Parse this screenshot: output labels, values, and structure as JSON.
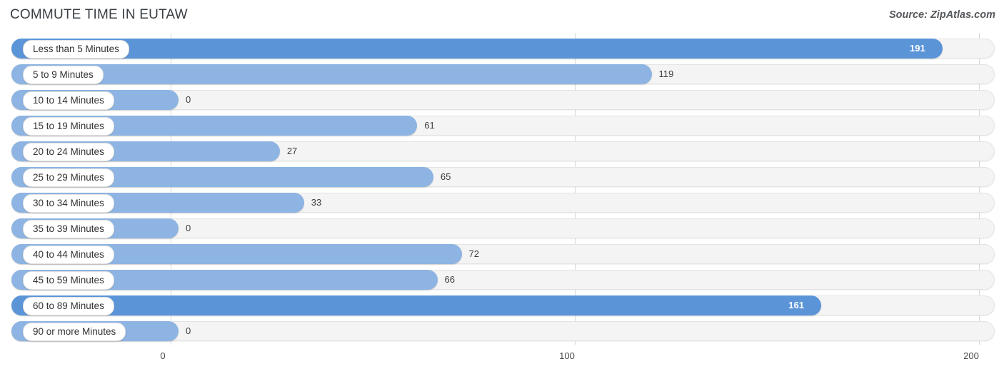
{
  "header": {
    "title": "COMMUTE TIME IN EUTAW",
    "source": "Source: ZipAtlas.com"
  },
  "axis": {
    "ticks": [
      "0",
      "100",
      "200"
    ]
  },
  "chart_data": {
    "type": "bar",
    "orientation": "horizontal",
    "title": "COMMUTE TIME IN EUTAW",
    "subtitle": "Source: ZipAtlas.com",
    "xlabel": "",
    "ylabel": "",
    "xlim": [
      0,
      200
    ],
    "xticks": [
      0,
      100,
      200
    ],
    "grid": true,
    "legend": false,
    "categories": [
      "Less than 5 Minutes",
      "5 to 9 Minutes",
      "10 to 14 Minutes",
      "15 to 19 Minutes",
      "20 to 24 Minutes",
      "25 to 29 Minutes",
      "30 to 34 Minutes",
      "35 to 39 Minutes",
      "40 to 44 Minutes",
      "45 to 59 Minutes",
      "60 to 89 Minutes",
      "90 or more Minutes"
    ],
    "values": [
      191,
      119,
      0,
      61,
      27,
      65,
      33,
      0,
      72,
      66,
      161,
      0
    ],
    "value_labels": [
      "191",
      "119",
      "0",
      "61",
      "27",
      "65",
      "33",
      "0",
      "72",
      "66",
      "161",
      "0"
    ],
    "colors": {
      "bar_light": "#8db4e2",
      "bar_dark": "#5b95d8",
      "track": "#f4f4f4",
      "gridline": "#d8d8d8",
      "title": "#3a3f45"
    }
  }
}
